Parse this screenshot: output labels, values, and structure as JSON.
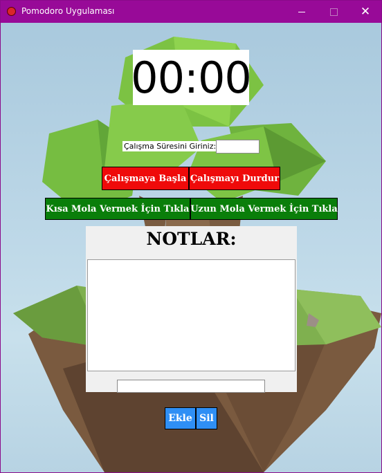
{
  "window": {
    "title": "Pomodoro Uygulaması",
    "accent": "#980a98"
  },
  "titlebar": {
    "icons": [
      "app-icon",
      "minimize-icon",
      "maximize-icon",
      "close-icon"
    ],
    "close_glyph": "✕"
  },
  "timer": {
    "display": "00:00"
  },
  "duration": {
    "label": "Çalışma Süresini Giriniz:",
    "value": ""
  },
  "controls": {
    "start_label": "Çalışmaya Başla",
    "stop_label": "Çalışmayı Durdur",
    "short_break_label": "Kısa Mola Vermek İçin Tıkla",
    "long_break_label": "Uzun Mola Vermek İçin Tıkla"
  },
  "notes": {
    "title": "NOTLAR:",
    "content": "",
    "input_value": ""
  },
  "note_actions": {
    "add_label": "Ekle",
    "delete_label": "Sil"
  },
  "colors": {
    "start": "#ef0a0a",
    "stop": "#ef0a0a",
    "break": "#0a7e0a",
    "note_buttons": "#2f8ff5"
  }
}
